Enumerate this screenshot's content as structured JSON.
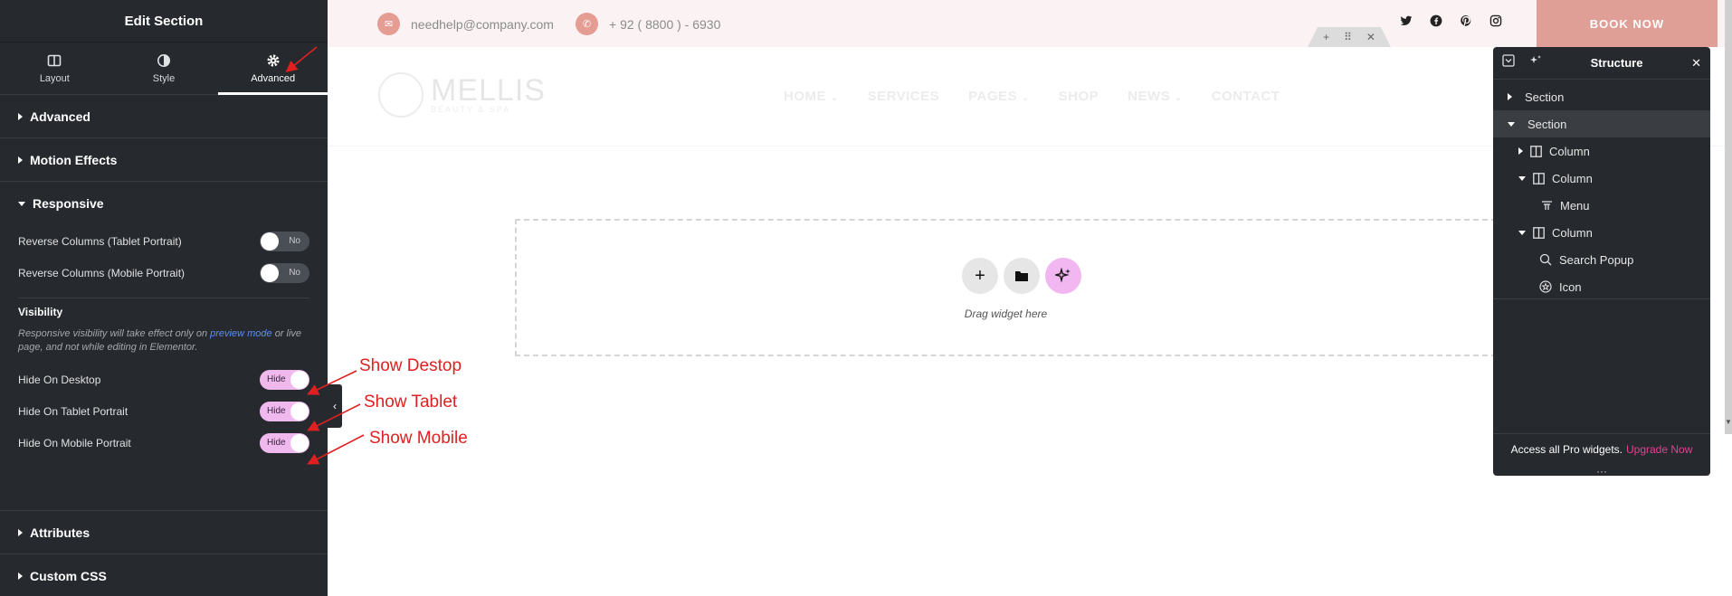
{
  "panel": {
    "title": "Edit Section",
    "tabs": [
      {
        "label": "Layout",
        "icon": "layout-icon"
      },
      {
        "label": "Style",
        "icon": "contrast-icon"
      },
      {
        "label": "Advanced",
        "icon": "gear-icon"
      }
    ],
    "sections": {
      "advanced": "Advanced",
      "motion": "Motion Effects",
      "responsive": "Responsive",
      "attributes": "Attributes",
      "custom_css": "Custom CSS"
    },
    "responsive": {
      "reverse_tablet": {
        "label": "Reverse Columns (Tablet Portrait)",
        "value": "No"
      },
      "reverse_mobile": {
        "label": "Reverse Columns (Mobile Portrait)",
        "value": "No"
      },
      "visibility_title": "Visibility",
      "visibility_desc_1": "Responsive visibility will take effect only on ",
      "visibility_desc_link": "preview mode",
      "visibility_desc_2": " or live page, and not while editing in Elementor.",
      "hide_desktop": {
        "label": "Hide On Desktop",
        "value": "Hide"
      },
      "hide_tablet": {
        "label": "Hide On Tablet Portrait",
        "value": "Hide"
      },
      "hide_mobile": {
        "label": "Hide On Mobile Portrait",
        "value": "Hide"
      }
    }
  },
  "annotations": {
    "desktop": "Show Destop",
    "tablet": "Show Tablet",
    "mobile": "Show Mobile"
  },
  "site": {
    "email": "needhelp@company.com",
    "phone": "+ 92 ( 8800 ) - 6930",
    "book_label": "BOOK NOW",
    "logo_name": "MELLIS",
    "logo_tag": "BEAUTY & SPA",
    "nav": [
      "HOME",
      "SERVICES",
      "PAGES",
      "SHOP",
      "NEWS",
      "CONTACT"
    ],
    "social_icons": [
      "twitter-icon",
      "facebook-icon",
      "pinterest-icon",
      "instagram-icon"
    ]
  },
  "dropzone": {
    "text": "Drag widget here"
  },
  "structure": {
    "title": "Structure",
    "items": [
      {
        "label": "Section",
        "icon": "caret-right-icon"
      },
      {
        "label": "Section",
        "icon": "caret-down-icon"
      },
      {
        "label": "Column",
        "icon": "column-icon"
      },
      {
        "label": "Column",
        "icon": "column-icon"
      },
      {
        "label": "Menu",
        "icon": "menu-icon"
      },
      {
        "label": "Column",
        "icon": "column-icon"
      },
      {
        "label": "Search Popup",
        "icon": "search-icon"
      },
      {
        "label": "Icon",
        "icon": "star-icon"
      }
    ],
    "footer_text": "Access all Pro widgets.",
    "footer_link": "Upgrade Now"
  },
  "colors": {
    "panel_bg": "#26292e",
    "accent_pink": "#f0b9ee",
    "book_button": "#df9e96",
    "annotation_red": "#e02020",
    "upgrade_link": "#e34291"
  }
}
